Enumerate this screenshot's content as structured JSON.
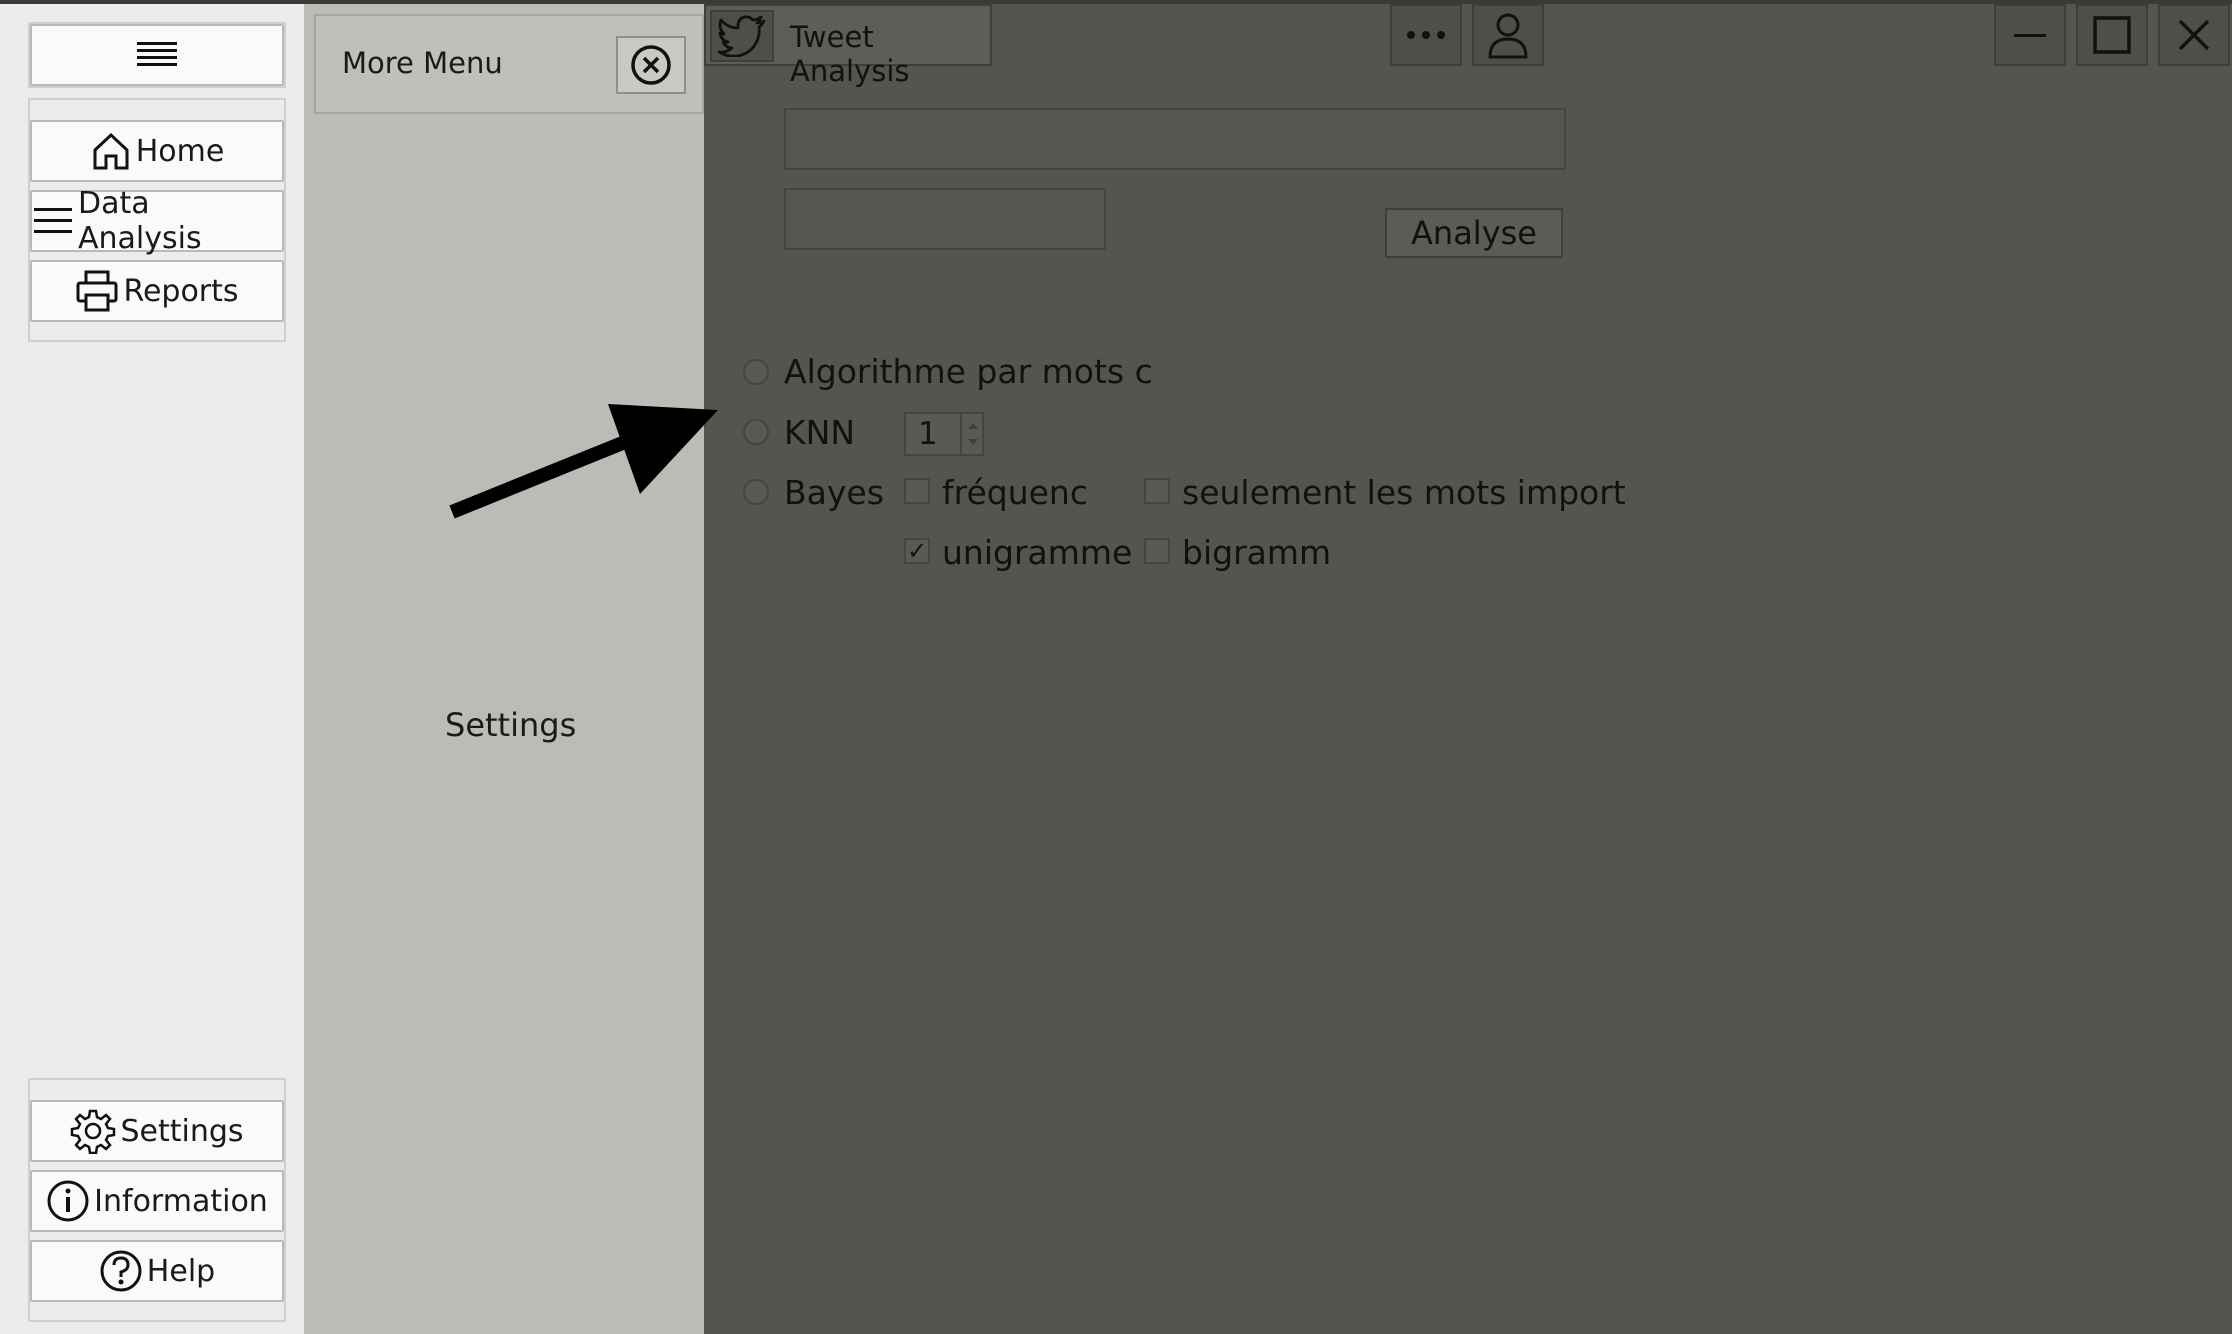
{
  "sidebar": {
    "items": [
      {
        "label": "Home",
        "icon": "home-icon"
      },
      {
        "label": "Data Analysis",
        "icon": "list-icon"
      },
      {
        "label": "Reports",
        "icon": "printer-icon"
      }
    ],
    "bottom_items": [
      {
        "label": "Settings",
        "icon": "gear-icon"
      },
      {
        "label": "Information",
        "icon": "info-icon"
      },
      {
        "label": "Help",
        "icon": "help-icon"
      }
    ]
  },
  "more_menu": {
    "title": "More Menu",
    "content_label": "Settings"
  },
  "window": {
    "title": "Tweet Analysis"
  },
  "form": {
    "input1_value": "",
    "input2_value": "",
    "analyse_label": "Analyse",
    "options": {
      "algo_keywords": "Algorithme par mots c",
      "knn": "KNN",
      "knn_value": "1",
      "bayes": "Bayes",
      "frequence": "fréquenc",
      "important_words": "seulement les mots importar",
      "unigramme": "unigramme",
      "bigramme": "bigramm"
    },
    "checked": {
      "frequence": false,
      "important_words": false,
      "unigramme": true,
      "bigramme": false
    }
  },
  "colors": {
    "main_bg": "#53564f",
    "panel_bg": "#babdb5",
    "sidebar_bg": "#ececec"
  }
}
